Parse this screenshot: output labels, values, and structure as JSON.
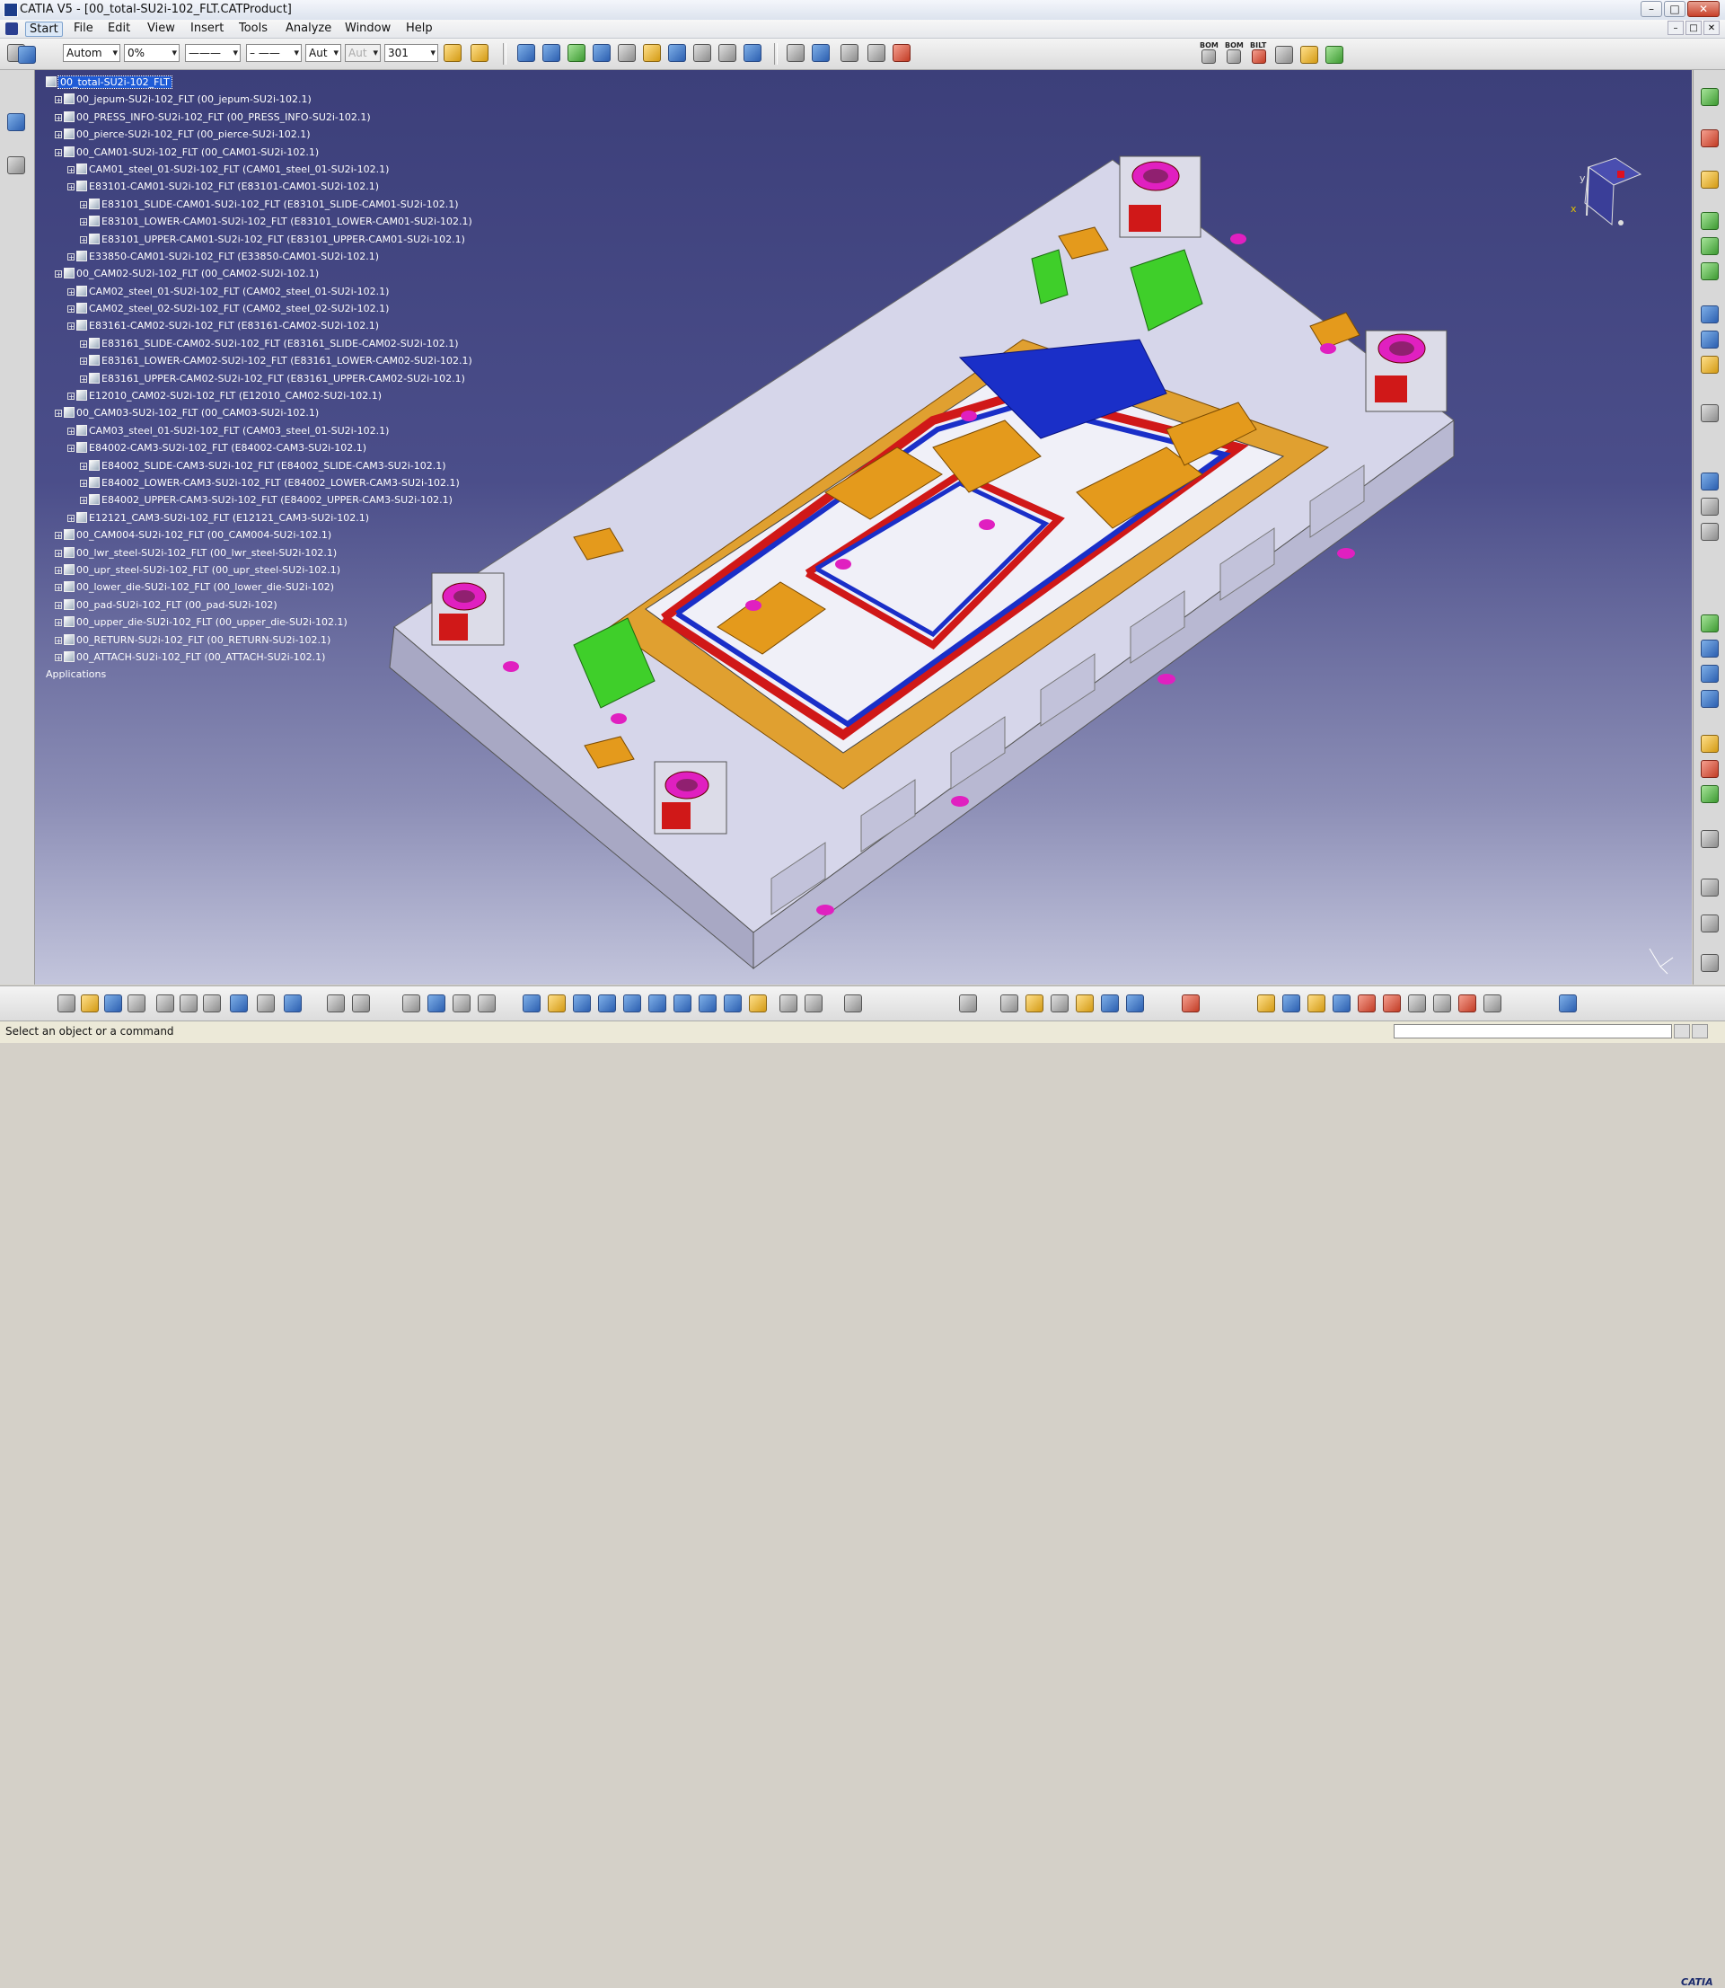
{
  "window": {
    "title": "CATIA V5 - [00_total-SU2i-102_FLT.CATProduct]",
    "min": "–",
    "max": "□",
    "close": "✕"
  },
  "menu": {
    "items": [
      "Start",
      "File",
      "Edit",
      "View",
      "Insert",
      "Tools",
      "Analyze",
      "Window",
      "Help"
    ]
  },
  "toolbar": {
    "combo_automatic": "Autom",
    "combo_transparency": "0%",
    "combo_linetype": "———",
    "combo_thickness": "– ——",
    "combo_auto1": "Aut",
    "combo_auto2": "Aut",
    "combo_layer": "301",
    "bom_labels": [
      "BOM",
      "BOM",
      "BILT"
    ]
  },
  "tree": {
    "root": "00_total-SU2i-102_FLT",
    "nodes": [
      {
        "label": "00_jepum-SU2i-102_FLT (00_jepum-SU2i-102.1)",
        "level": 1
      },
      {
        "label": "00_PRESS_INFO-SU2i-102_FLT (00_PRESS_INFO-SU2i-102.1)",
        "level": 1
      },
      {
        "label": "00_pierce-SU2i-102_FLT (00_pierce-SU2i-102.1)",
        "level": 1
      },
      {
        "label": "00_CAM01-SU2i-102_FLT (00_CAM01-SU2i-102.1)",
        "level": 1
      },
      {
        "label": "CAM01_steel_01-SU2i-102_FLT (CAM01_steel_01-SU2i-102.1)",
        "level": 2
      },
      {
        "label": "E83101-CAM01-SU2i-102_FLT (E83101-CAM01-SU2i-102.1)",
        "level": 2
      },
      {
        "label": "E83101_SLIDE-CAM01-SU2i-102_FLT (E83101_SLIDE-CAM01-SU2i-102.1)",
        "level": 3
      },
      {
        "label": "E83101_LOWER-CAM01-SU2i-102_FLT (E83101_LOWER-CAM01-SU2i-102.1)",
        "level": 3
      },
      {
        "label": "E83101_UPPER-CAM01-SU2i-102_FLT (E83101_UPPER-CAM01-SU2i-102.1)",
        "level": 3
      },
      {
        "label": "E33850-CAM01-SU2i-102_FLT (E33850-CAM01-SU2i-102.1)",
        "level": 2
      },
      {
        "label": "00_CAM02-SU2i-102_FLT (00_CAM02-SU2i-102.1)",
        "level": 1
      },
      {
        "label": "CAM02_steel_01-SU2i-102_FLT (CAM02_steel_01-SU2i-102.1)",
        "level": 2
      },
      {
        "label": "CAM02_steel_02-SU2i-102_FLT (CAM02_steel_02-SU2i-102.1)",
        "level": 2
      },
      {
        "label": "E83161-CAM02-SU2i-102_FLT (E83161-CAM02-SU2i-102.1)",
        "level": 2
      },
      {
        "label": "E83161_SLIDE-CAM02-SU2i-102_FLT (E83161_SLIDE-CAM02-SU2i-102.1)",
        "level": 3
      },
      {
        "label": "E83161_LOWER-CAM02-SU2i-102_FLT (E83161_LOWER-CAM02-SU2i-102.1)",
        "level": 3
      },
      {
        "label": "E83161_UPPER-CAM02-SU2i-102_FLT (E83161_UPPER-CAM02-SU2i-102.1)",
        "level": 3
      },
      {
        "label": "E12010_CAM02-SU2i-102_FLT (E12010_CAM02-SU2i-102.1)",
        "level": 2
      },
      {
        "label": "00_CAM03-SU2i-102_FLT (00_CAM03-SU2i-102.1)",
        "level": 1
      },
      {
        "label": "CAM03_steel_01-SU2i-102_FLT (CAM03_steel_01-SU2i-102.1)",
        "level": 2
      },
      {
        "label": "E84002-CAM3-SU2i-102_FLT (E84002-CAM3-SU2i-102.1)",
        "level": 2
      },
      {
        "label": "E84002_SLIDE-CAM3-SU2i-102_FLT (E84002_SLIDE-CAM3-SU2i-102.1)",
        "level": 3
      },
      {
        "label": "E84002_LOWER-CAM3-SU2i-102_FLT (E84002_LOWER-CAM3-SU2i-102.1)",
        "level": 3
      },
      {
        "label": "E84002_UPPER-CAM3-SU2i-102_FLT (E84002_UPPER-CAM3-SU2i-102.1)",
        "level": 3
      },
      {
        "label": "E12121_CAM3-SU2i-102_FLT (E12121_CAM3-SU2i-102.1)",
        "level": 2
      },
      {
        "label": "00_CAM004-SU2i-102_FLT (00_CAM004-SU2i-102.1)",
        "level": 1
      },
      {
        "label": "00_lwr_steel-SU2i-102_FLT (00_lwr_steel-SU2i-102.1)",
        "level": 1
      },
      {
        "label": "00_upr_steel-SU2i-102_FLT (00_upr_steel-SU2i-102.1)",
        "level": 1
      },
      {
        "label": "00_lower_die-SU2i-102_FLT (00_lower_die-SU2i-102)",
        "level": 1
      },
      {
        "label": "00_pad-SU2i-102_FLT (00_pad-SU2i-102)",
        "level": 1
      },
      {
        "label": "00_upper_die-SU2i-102_FLT (00_upper_die-SU2i-102.1)",
        "level": 1
      },
      {
        "label": "00_RETURN-SU2i-102_FLT (00_RETURN-SU2i-102.1)",
        "level": 1
      },
      {
        "label": "00_ATTACH-SU2i-102_FLT (00_ATTACH-SU2i-102.1)",
        "level": 1
      }
    ],
    "applications": "Applications"
  },
  "compass": {
    "y_label": "y",
    "x_label": "x"
  },
  "status": {
    "message": "Select an object or a command"
  },
  "logo": "CATIA",
  "colors": {
    "viewport_top": "#3c3f7a",
    "viewport_bottom": "#c3c5dc",
    "tree_selection": "#1f5bd6",
    "die_orange": "#e49a1c",
    "die_blue": "#1a2fc8",
    "die_red": "#d01818",
    "magenta": "#e020c0"
  }
}
